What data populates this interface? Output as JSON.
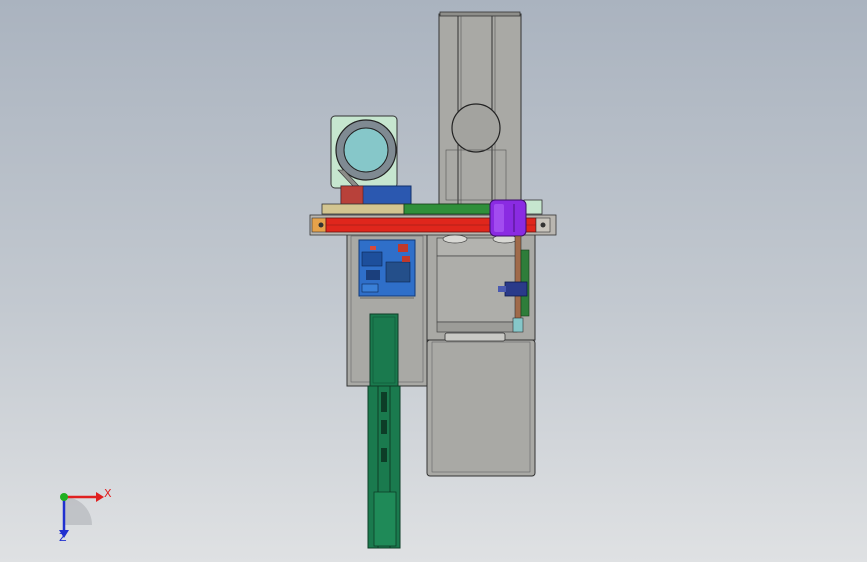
{
  "colors": {
    "background_top": "#aab3bf",
    "background_bottom": "#dfe1e3",
    "body_gray": "#a9a9a5",
    "conveyor_green": "#1a7a4e",
    "beam_red": "#e0261c",
    "motor_mint": "#c6e6cf",
    "motor_face": "#86c7c9",
    "cylinder_purple": "#8a2be2",
    "pcb_blue": "#2f6fc9",
    "x_axis": "#e02020",
    "y_axis": "#20b020",
    "z_axis": "#2030d0"
  },
  "view_triad": {
    "x_label": "X",
    "z_label": "Z"
  }
}
